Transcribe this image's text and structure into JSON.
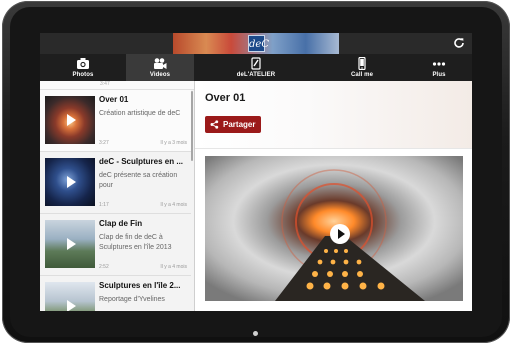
{
  "colors": {
    "accent": "#9b1a1a",
    "tabbar": "#1e1e1e",
    "active_tab": "#3a3a3a",
    "banner_logo": "#1d4a8a"
  },
  "banner": {
    "logo_text": "deC"
  },
  "tabs": [
    {
      "label": "Photos",
      "icon": "camera-icon"
    },
    {
      "label": "Videos",
      "icon": "video-camera-icon",
      "active": true
    },
    {
      "label": "deL'ATELIER",
      "icon": "document-icon"
    },
    {
      "label": "Call me",
      "icon": "phone-icon"
    },
    {
      "label": "Plus",
      "icon": "more-icon"
    }
  ],
  "list": {
    "cutoff_top_text": "3:47",
    "items": [
      {
        "title": "Over 01",
        "description": "Création artistique de deC",
        "duration": "3:27",
        "ago": "Il y a 3 mois"
      },
      {
        "title": "deC - Sculptures en ...",
        "description": "deC présente sa création pour",
        "duration": "1:17",
        "ago": "Il y a 4 mois"
      },
      {
        "title": "Clap de Fin",
        "description": "Clap de fin de deC à Sculptures en l'île 2013",
        "duration": "2:52",
        "ago": "Il y a 4 mois"
      },
      {
        "title": "Sculptures en l'île 2...",
        "description": "Reportage d'Yvelines",
        "duration": "",
        "ago": ""
      }
    ]
  },
  "detail": {
    "title": "Over 01",
    "share_label": "Partager"
  }
}
